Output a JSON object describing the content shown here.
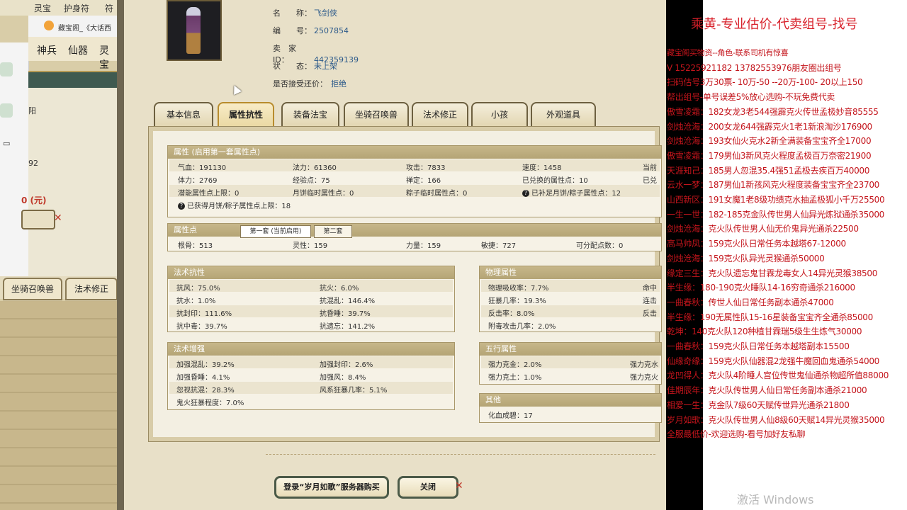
{
  "left_window": {
    "top_labels": [
      "灵宝",
      "护身符",
      "符"
    ],
    "browser_tab": "藏宝阁_《大话西",
    "menu": [
      "神兵",
      "仙器",
      "灵宝"
    ],
    "sidebar_texts": [
      "阳",
      "92"
    ],
    "price": "0 (元)",
    "bottom_tabs": [
      "坐骑召唤兽",
      "法术修正"
    ]
  },
  "char": {
    "rows": [
      {
        "k": "名　　称：",
        "v": "飞剑侠"
      },
      {
        "k": "编　　号：",
        "v": "2507854"
      },
      {
        "k": "卖　家　ID：",
        "v": "442359139"
      },
      {
        "k": "状　　态：",
        "v": "未上架"
      },
      {
        "k": "是否接受还价：",
        "v": "拒绝"
      }
    ]
  },
  "tabs": [
    "基本信息",
    "属性抗性",
    "装备法宝",
    "坐骑召唤兽",
    "法术修正",
    "小孩",
    "外观道具"
  ],
  "attr": {
    "header": "属性 (启用第一套属性点)",
    "r1": [
      "气血：191130",
      "法力：61360",
      "攻击：7833",
      "速度：1458",
      "当前"
    ],
    "r2": [
      "体力：2769",
      "经验点：75",
      "禅定：166",
      "已兑换的属性点：10",
      "已兑"
    ],
    "r3": [
      "潜能属性点上限：0",
      "月饼临时属性点：0",
      "粽子临时属性点：0",
      "已补足月饼/粽子属性点：12"
    ],
    "r4": "已获得月饼/粽子属性点上限：18"
  },
  "points": {
    "header": "属性点",
    "tab1": "第一套 (当前启用)",
    "tab2": "第二套",
    "row": [
      "根骨：513",
      "灵性：159",
      "力量：159",
      "敏捷：727",
      "可分配点数：0"
    ]
  },
  "resist": {
    "header": "法术抗性",
    "rows": [
      [
        "抗风：75.0%",
        "抗火：6.0%"
      ],
      [
        "抗水：1.0%",
        "抗混乱：146.4%"
      ],
      [
        "抗封印：111.6%",
        "抗昏睡：39.7%"
      ],
      [
        "抗中毒：39.7%",
        "抗遗忘：141.2%"
      ]
    ]
  },
  "enhance": {
    "header": "法术增强",
    "rows": [
      [
        "加强混乱：39.2%",
        "加强封印：2.6%"
      ],
      [
        "加强昏睡：4.1%",
        "加强风：8.4%"
      ],
      [
        "忽视抗混：28.3%",
        "风系狂暴几率：5.1%"
      ],
      [
        "鬼火狂暴程度：7.0%",
        ""
      ]
    ]
  },
  "physical": {
    "header": "物理属性",
    "rows": [
      [
        "物理吸收率：7.7%",
        "命中"
      ],
      [
        "狂暴几率：19.3%",
        "连击"
      ],
      [
        "反击率：8.0%",
        "反击"
      ],
      [
        "附毒攻击几率：2.0%",
        ""
      ]
    ]
  },
  "elements": {
    "header": "五行属性",
    "rows": [
      [
        "强力克金：2.0%",
        "强力克水"
      ],
      [
        "强力克土：1.0%",
        "强力克火"
      ]
    ]
  },
  "other": {
    "header": "其他",
    "row": "化血成碧：17"
  },
  "buttons": {
    "purchase": "登录“岁月如歌”服务器购买",
    "close": "关闭"
  },
  "overlay": {
    "title": "乘黄-专业估价-代卖组号-找号",
    "lines": [
      "藏宝阁买物资--角色-联系司机有惊喜",
      "V 15225921182  13782553976朋友圈出组号",
      "扫码估号3万30票- 10万-50 --20万-100- 20以上150",
      "帮出组号-单号误差5%放心选购-不玩免费代卖",
      "傲雪凌霜：182女龙3老544强霹克火传世孟极妙音85555",
      "剑烛沧海：200女龙644强霹克火1老1新浪淘沙176900",
      "剑烛沧海：193女仙火克水2新全满装备宝宝齐全17000",
      "傲雪凌霜：179男仙3新风克火程度孟极百万奈密21900",
      "天涯知己：185男人忽混35.4强51孟极去疾百万40000",
      "云水一梦：187男仙1新孩风克火程度装备宝宝齐全23700",
      "山西新区：191女魔1老8级功绩克水抽孟极狐小千万25500",
      "一生一世：182-185克金队传世男人仙异光炼狱通杀35000",
      "剑烛沧海：克火队传世男人仙无价鬼异光通杀22500",
      "高马帅凤：159克火队日常任务本越塔67-12000",
      "剑烛沧海：159克火队异光灵猴通杀50000",
      "缘定三生：克火队遗忘鬼甘霖龙毒女人14异光灵猴38500",
      "半生缘：180-190克火睡队14-16穷奇通杀216000",
      "一曲春秋：传世人仙日常任务副本通杀47000",
      "半生缘：190无属性队15-16星装备宝宝齐全通杀85000",
      "乾坤：140克火队120种植甘霖瑞5级生生炼气30000",
      "一曲春秋：159克火队日常任务本越塔副本15500",
      "仙缘奇缘：159克火队仙器混2龙强牛魔回血鬼通杀54000",
      "龙凹得人：克火队4阶睡人宫位传世鬼仙通杀物超所值88000",
      "佳期辰年：克火队传世男人仙日常任务副本通杀21000",
      "相爱一生：克金队7级60天赋传世异光通杀21800",
      "岁月如歌：克火队传世男人仙8级60天赋14异光灵猴35000",
      "全服最低价-欢迎选购-看号加好友私聊"
    ]
  },
  "watermark": "激活 Windows"
}
